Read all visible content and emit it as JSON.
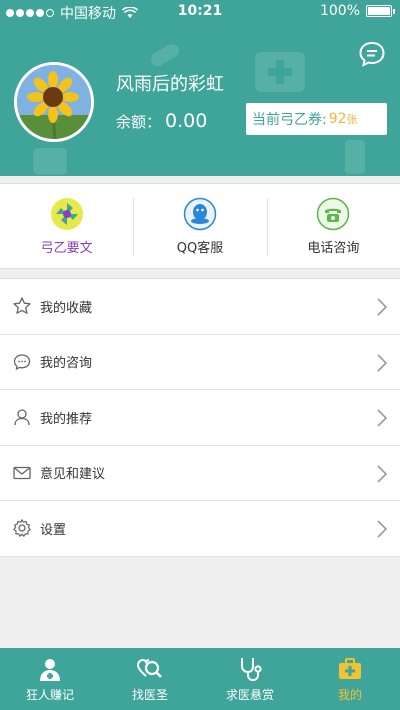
{
  "status_bar": {
    "carrier": "中国移动",
    "time": "10:21",
    "battery": "100%"
  },
  "profile": {
    "username": "风雨后的彩虹",
    "balance_label": "余额：",
    "balance_value": "0.00",
    "coupon_label": "当前弓乙券:",
    "coupon_value": "92",
    "coupon_unit": "张"
  },
  "quick_actions": [
    {
      "label": "弓乙要文",
      "icon": "pinwheel-icon"
    },
    {
      "label": "QQ客服",
      "icon": "qq-icon"
    },
    {
      "label": "电话咨询",
      "icon": "phone-icon"
    }
  ],
  "menu": [
    {
      "label": "我的收藏",
      "icon": "star-icon"
    },
    {
      "label": "我的咨询",
      "icon": "chat-bubble-icon"
    },
    {
      "label": "我的推荐",
      "icon": "user-icon"
    },
    {
      "label": "意见和建议",
      "icon": "mail-icon"
    },
    {
      "label": "设置",
      "icon": "gear-icon"
    }
  ],
  "tabs": [
    {
      "label": "狂人赚记",
      "icon": "doctor-icon"
    },
    {
      "label": "找医圣",
      "icon": "search-heart-icon"
    },
    {
      "label": "求医悬赏",
      "icon": "stethoscope-icon"
    },
    {
      "label": "我的",
      "icon": "medkit-icon",
      "active": true
    }
  ],
  "colors": {
    "primary": "#3fa59a",
    "accent": "#f1c232",
    "active_quick": "#8a3fc2"
  }
}
